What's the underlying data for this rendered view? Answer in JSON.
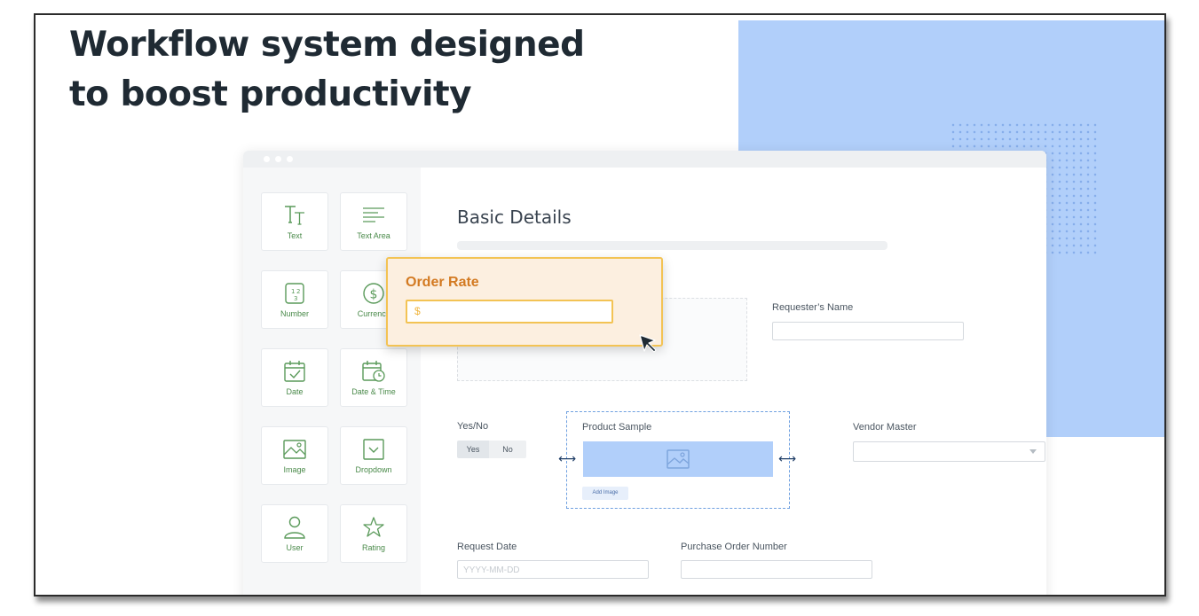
{
  "headline": {
    "line1": "Workflow system designed",
    "line2": "to boost productivity"
  },
  "colors": {
    "accent_blue": "#b1cffa",
    "field_green": "#4a8a4a",
    "order_orange": "#d37a22",
    "order_border": "#f3c354"
  },
  "sidebar": {
    "fields": [
      {
        "label": "Text",
        "icon": "text-icon"
      },
      {
        "label": "Text Area",
        "icon": "text-area-icon"
      },
      {
        "label": "Number",
        "icon": "number-icon"
      },
      {
        "label": "Currency",
        "icon": "currency-icon"
      },
      {
        "label": "Date",
        "icon": "date-icon"
      },
      {
        "label": "Date & Time",
        "icon": "date-time-icon"
      },
      {
        "label": "Image",
        "icon": "image-icon"
      },
      {
        "label": "Dropdown",
        "icon": "dropdown-icon"
      },
      {
        "label": "User",
        "icon": "user-icon"
      },
      {
        "label": "Rating",
        "icon": "star-icon"
      }
    ]
  },
  "form": {
    "title": "Basic Details",
    "requester_label": "Requester’s Name",
    "yesno_label": "Yes/No",
    "yes_label": "Yes",
    "no_label": "No",
    "product_sample_label": "Product Sample",
    "add_image_label": "Add Image",
    "vendor_master_label": "Vendor Master",
    "request_date_label": "Request Date",
    "request_date_placeholder": "YYYY-MM-DD",
    "po_number_label": "Purchase Order Number"
  },
  "order_rate": {
    "title": "Order Rate",
    "placeholder": "$"
  }
}
